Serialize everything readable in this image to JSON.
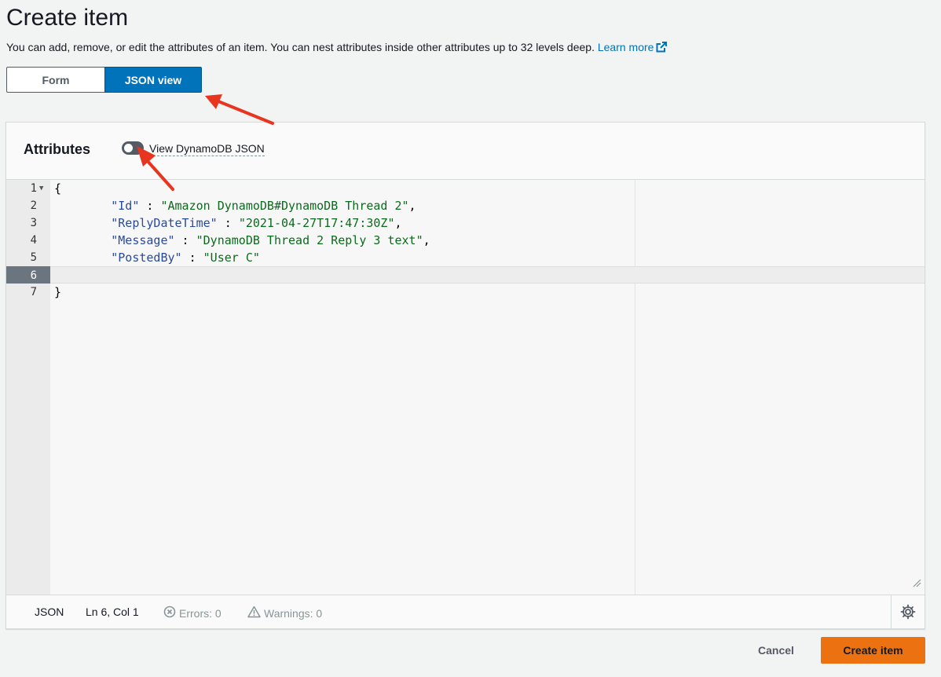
{
  "header": {
    "title": "Create item",
    "description": "You can add, remove, or edit the attributes of an item. You can nest attributes inside other attributes up to 32 levels deep.",
    "learn_more": "Learn more"
  },
  "view_tabs": [
    {
      "label": "Form",
      "selected": false
    },
    {
      "label": "JSON view",
      "selected": true
    }
  ],
  "attributes_panel": {
    "title": "Attributes",
    "toggle_label": "View DynamoDB JSON",
    "toggle_on": false
  },
  "editor": {
    "lines": [
      {
        "n": "1",
        "brace": "{"
      },
      {
        "n": "2",
        "key": "\"Id\"",
        "sep": " : ",
        "val": "\"Amazon DynamoDB#DynamoDB Thread 2\"",
        "end": ","
      },
      {
        "n": "3",
        "key": "\"ReplyDateTime\"",
        "sep": " : ",
        "val": "\"2021-04-27T17:47:30Z\"",
        "end": ","
      },
      {
        "n": "4",
        "key": "\"Message\"",
        "sep": " : ",
        "val": "\"DynamoDB Thread 2 Reply 3 text\"",
        "end": ","
      },
      {
        "n": "5",
        "key": "\"PostedBy\"",
        "sep": " : ",
        "val": "\"User C\"",
        "end": ""
      },
      {
        "n": "6"
      },
      {
        "n": "7",
        "brace": "}"
      }
    ],
    "active_line": 6
  },
  "status_bar": {
    "language": "JSON",
    "cursor": "Ln 6, Col 1",
    "errors": "Errors: 0",
    "warnings": "Warnings: 0"
  },
  "footer": {
    "cancel_label": "Cancel",
    "create_label": "Create item"
  },
  "colors": {
    "primary": "#0073bb",
    "create_button": "#ec7211",
    "annotation_arrow": "#e8351f"
  }
}
